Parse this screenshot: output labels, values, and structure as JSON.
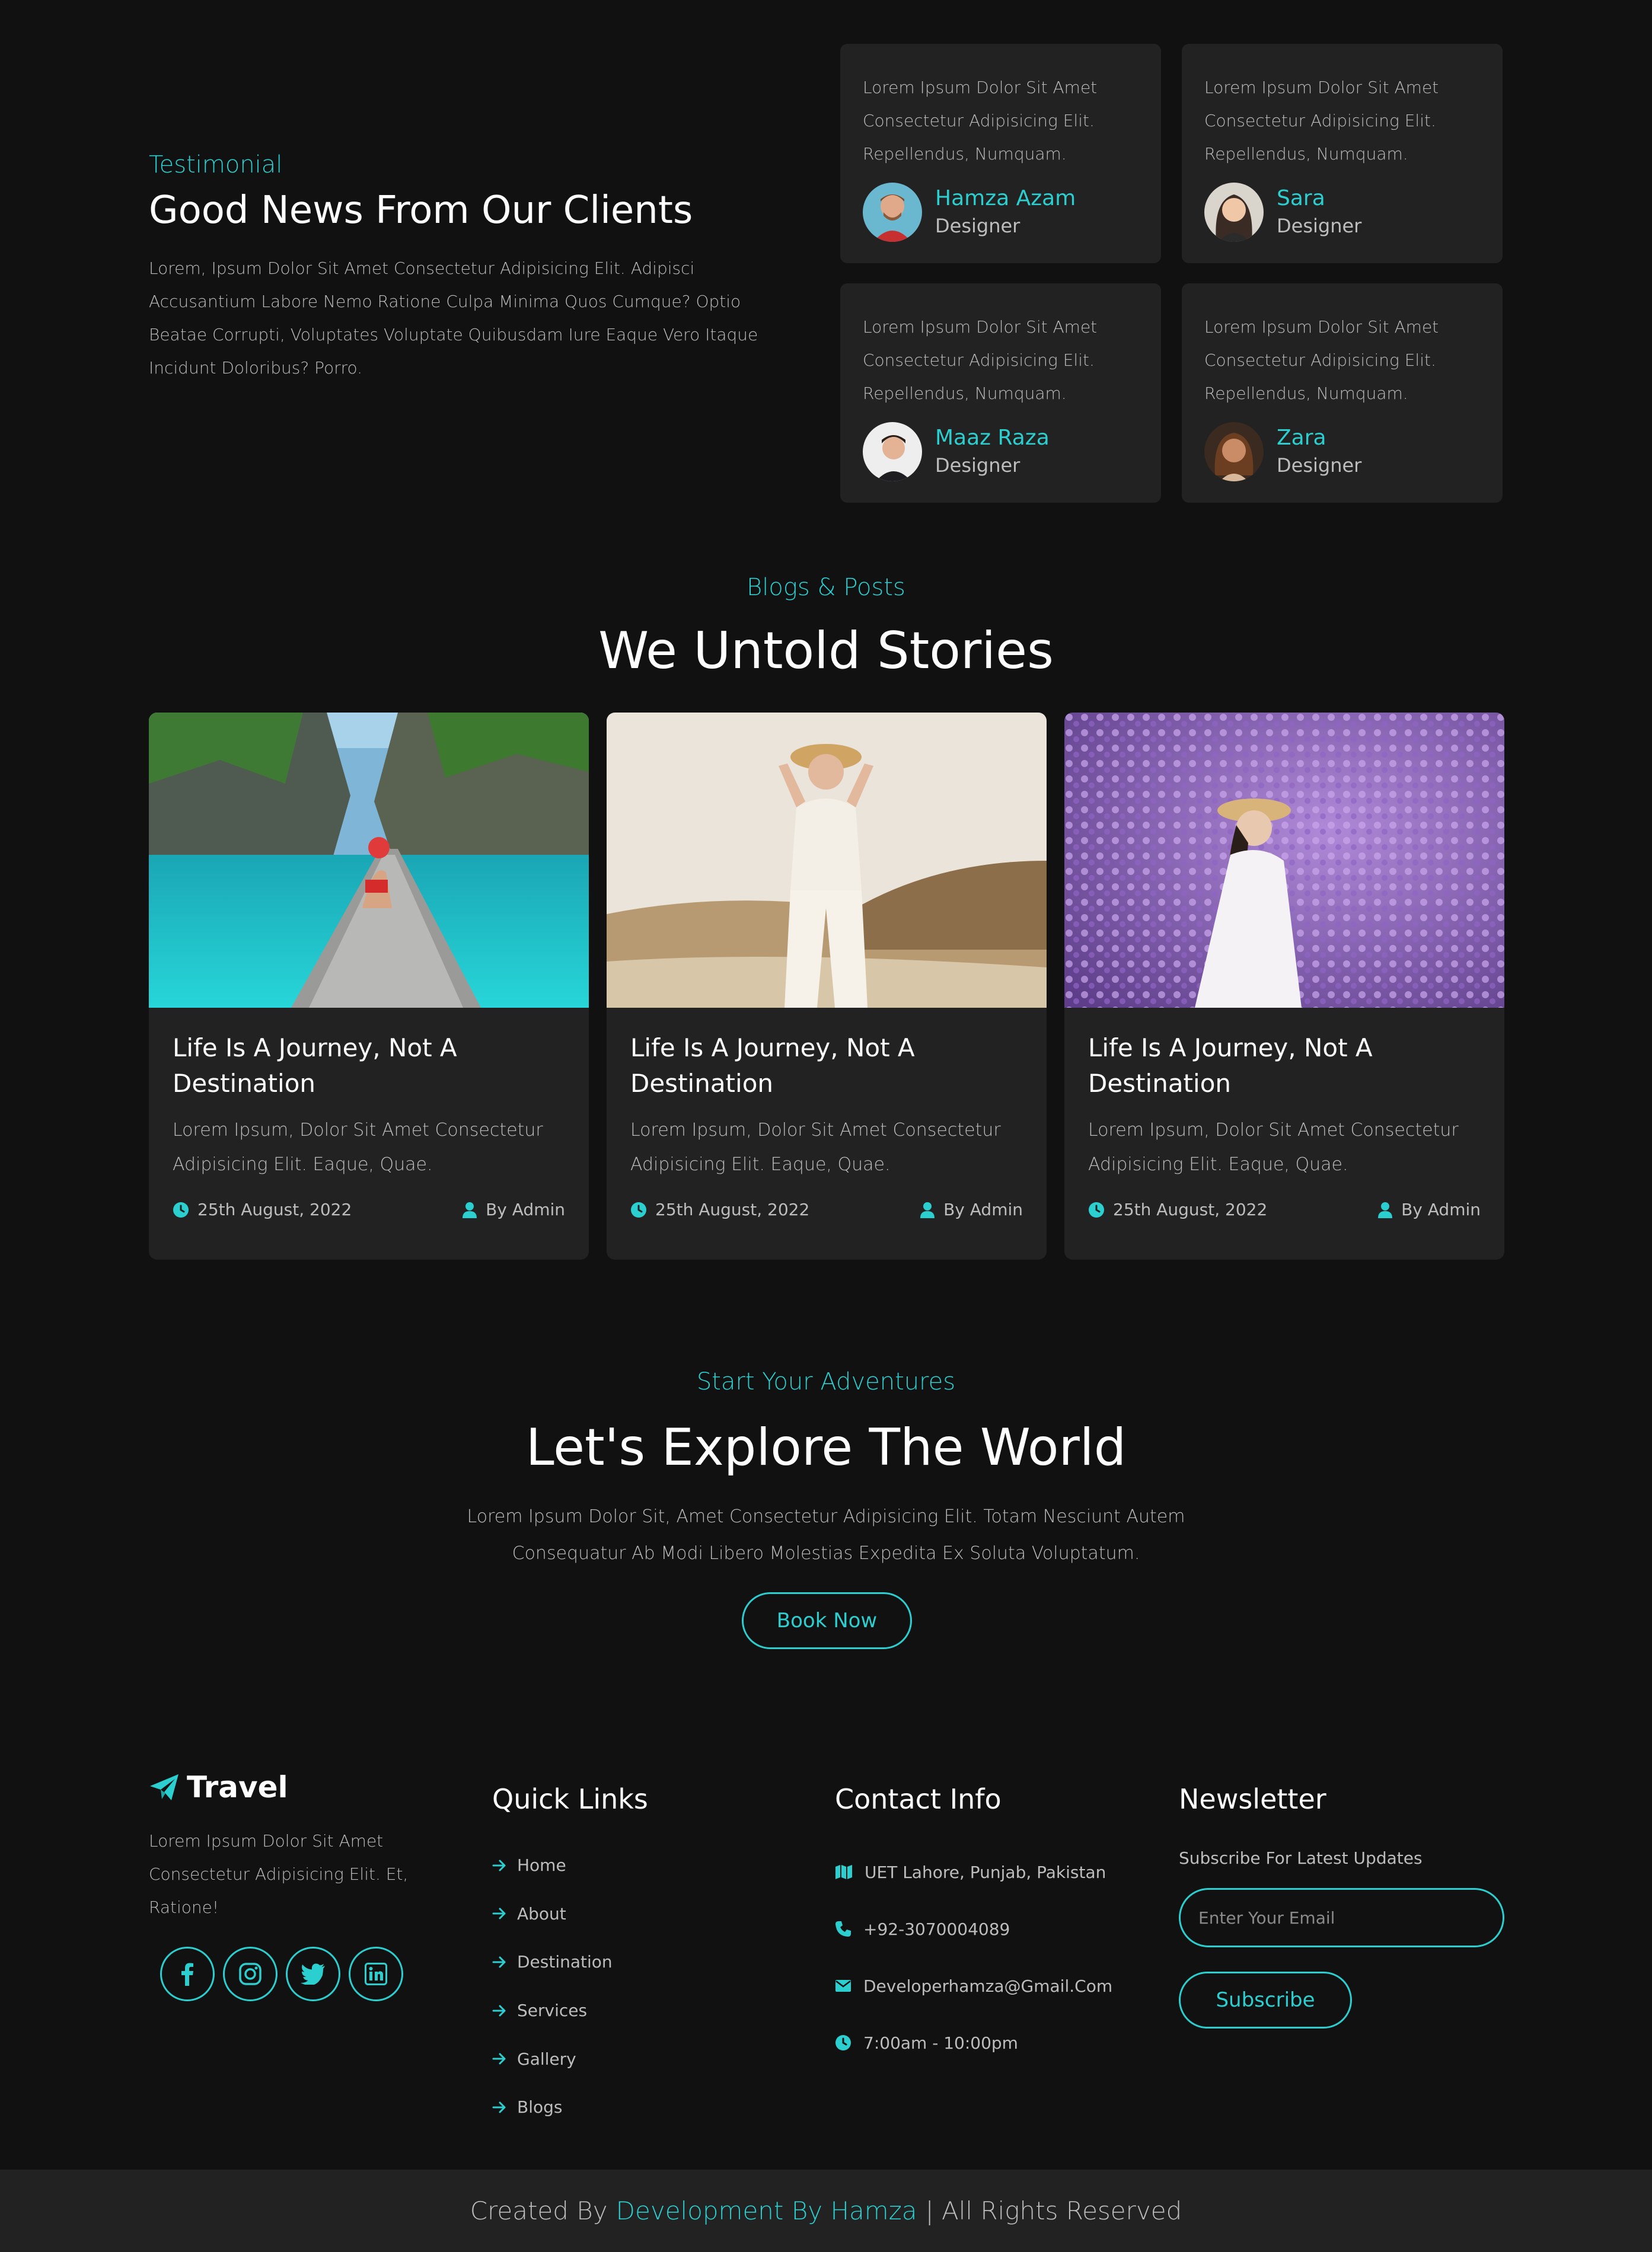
{
  "colors": {
    "accent": "#2ccfcf",
    "background": "#111111",
    "card": "#222222",
    "muted_text": "#bdbdbd"
  },
  "testimonial": {
    "eyebrow": "Testimonial",
    "title": "Good News From Our Clients",
    "text": "Lorem, Ipsum Dolor Sit Amet Consectetur Adipisicing Elit. Adipisci Accusantium Labore Nemo Ratione Culpa Minima Quos Cumque? Optio Beatae Corrupti, Voluptates Voluptate Quibusdam Iure Eaque Vero Itaque Incidunt Doloribus? Porro.",
    "cards": [
      {
        "quote": "Lorem Ipsum Dolor Sit Amet Consectetur Adipisicing Elit. Repellendus, Numquam.",
        "name": "Hamza Azam",
        "role": "Designer"
      },
      {
        "quote": "Lorem Ipsum Dolor Sit Amet Consectetur Adipisicing Elit. Repellendus, Numquam.",
        "name": "Sara",
        "role": "Designer"
      },
      {
        "quote": "Lorem Ipsum Dolor Sit Amet Consectetur Adipisicing Elit. Repellendus, Numquam.",
        "name": "Maaz Raza",
        "role": "Designer"
      },
      {
        "quote": "Lorem Ipsum Dolor Sit Amet Consectetur Adipisicing Elit. Repellendus, Numquam.",
        "name": "Zara",
        "role": "Designer"
      }
    ]
  },
  "blogs": {
    "eyebrow": "Blogs & Posts",
    "title": "We Untold Stories",
    "posts": [
      {
        "title": "Life Is A Journey, Not A Destination",
        "description": "Lorem Ipsum, Dolor Sit Amet Consectetur Adipisicing Elit. Eaque, Quae.",
        "date": "25th August, 2022",
        "author": "By Admin"
      },
      {
        "title": "Life Is A Journey, Not A Destination",
        "description": "Lorem Ipsum, Dolor Sit Amet Consectetur Adipisicing Elit. Eaque, Quae.",
        "date": "25th August, 2022",
        "author": "By Admin"
      },
      {
        "title": "Life Is A Journey, Not A Destination",
        "description": "Lorem Ipsum, Dolor Sit Amet Consectetur Adipisicing Elit. Eaque, Quae.",
        "date": "25th August, 2022",
        "author": "By Admin"
      }
    ]
  },
  "adventure": {
    "eyebrow": "Start Your Adventures",
    "title": "Let's Explore The World",
    "text": "Lorem Ipsum Dolor Sit, Amet Consectetur Adipisicing Elit. Totam Nesciunt Autem Consequatur Ab Modi Libero Molestias Expedita Ex Soluta Voluptatum.",
    "button": "Book Now"
  },
  "footer": {
    "logo": "Travel",
    "about": "Lorem Ipsum Dolor Sit Amet Consectetur Adipisicing Elit. Et, Ratione!",
    "social_icons": [
      "facebook-icon",
      "instagram-icon",
      "twitter-icon",
      "linkedin-icon"
    ],
    "quick_links": {
      "title": "Quick Links",
      "items": [
        "Home",
        "About",
        "Destination",
        "Services",
        "Gallery",
        "Blogs"
      ]
    },
    "contact": {
      "title": "Contact Info",
      "items": [
        {
          "icon": "map-icon",
          "text": "UET Lahore, Punjab, Pakistan"
        },
        {
          "icon": "phone-icon",
          "text": "+92-3070004089"
        },
        {
          "icon": "envelope-icon",
          "text": "Developerhamza@Gmail.Com"
        },
        {
          "icon": "clock-icon",
          "text": "7:00am - 10:00pm"
        }
      ]
    },
    "newsletter": {
      "title": "Newsletter",
      "subtitle": "Subscribe For Latest Updates",
      "placeholder": "Enter Your Email",
      "button": "Subscribe"
    }
  },
  "copyright": {
    "prefix": "Created By",
    "link": "Development By Hamza",
    "suffix": "| All Rights Reserved"
  }
}
